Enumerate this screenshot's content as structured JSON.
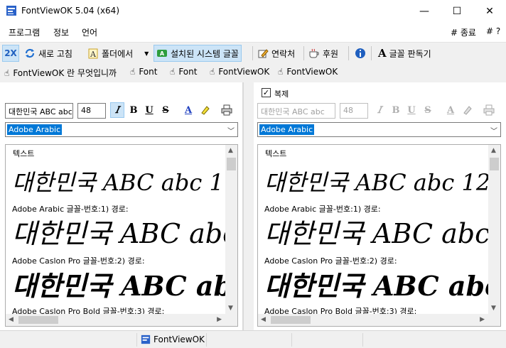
{
  "window": {
    "title": "FontViewOK 5.04   (x64)",
    "minimize": "—",
    "maximize": "☐",
    "close": "✕"
  },
  "menu": {
    "items": [
      "프로그램",
      "정보",
      "언어"
    ],
    "right_items": [
      "# 종료",
      "# ?"
    ]
  },
  "toolbar": {
    "zoom_label": "2X",
    "refresh_label": "새로 고침",
    "from_folder_label": "폴더에서",
    "installed_label": "설치된 시스템 글꼴",
    "contact_label": "연락처",
    "donate_label": "후원",
    "font_reader_label": "글꼴 판독기"
  },
  "linkbar": {
    "items": [
      "FontViewOK 란 무엇입니까",
      "Font",
      "Font",
      "FontViewOK",
      "FontViewOK"
    ]
  },
  "left_pane": {
    "sample_text": "대한민국 ABC abc",
    "size": "48",
    "font_selected": "Adobe Arabic",
    "preview_label": "텍스트",
    "preview_sample": "대한민국 ABC abc 1",
    "fonts": [
      {
        "info": "Adobe Arabic 글꼴-번호:1) 경로:",
        "sample": "대한민국 ABC abc"
      },
      {
        "info": "Adobe Caslon Pro 글꼴-번호:2) 경로:",
        "sample": "대한민국 ABC abc"
      },
      {
        "info": "Adobe Caslon Pro Bold 글꼴-번호:3) 경로:"
      }
    ]
  },
  "right_pane": {
    "copy_label": "복제",
    "copy_checked": true,
    "sample_text": "대한민국 ABC abc",
    "size": "48",
    "font_selected": "Adobe Arabic",
    "preview_label": "텍스트",
    "preview_sample": "대한민국 ABC abc 12",
    "fonts": [
      {
        "info": "Adobe Arabic 글꼴-번호:1) 경로:",
        "sample": "대한민국 ABC abc"
      },
      {
        "info": "Adobe Caslon Pro 글꼴-번호:2) 경로:",
        "sample": "대한민국 ABC abc"
      },
      {
        "info": "Adobe Caslon Pro Bold 글꼴-번호:3) 경로:"
      }
    ]
  },
  "status": {
    "label": "FontViewOK"
  },
  "colors": {
    "accent": "#0078d7",
    "active_bg": "#cce4f7"
  }
}
